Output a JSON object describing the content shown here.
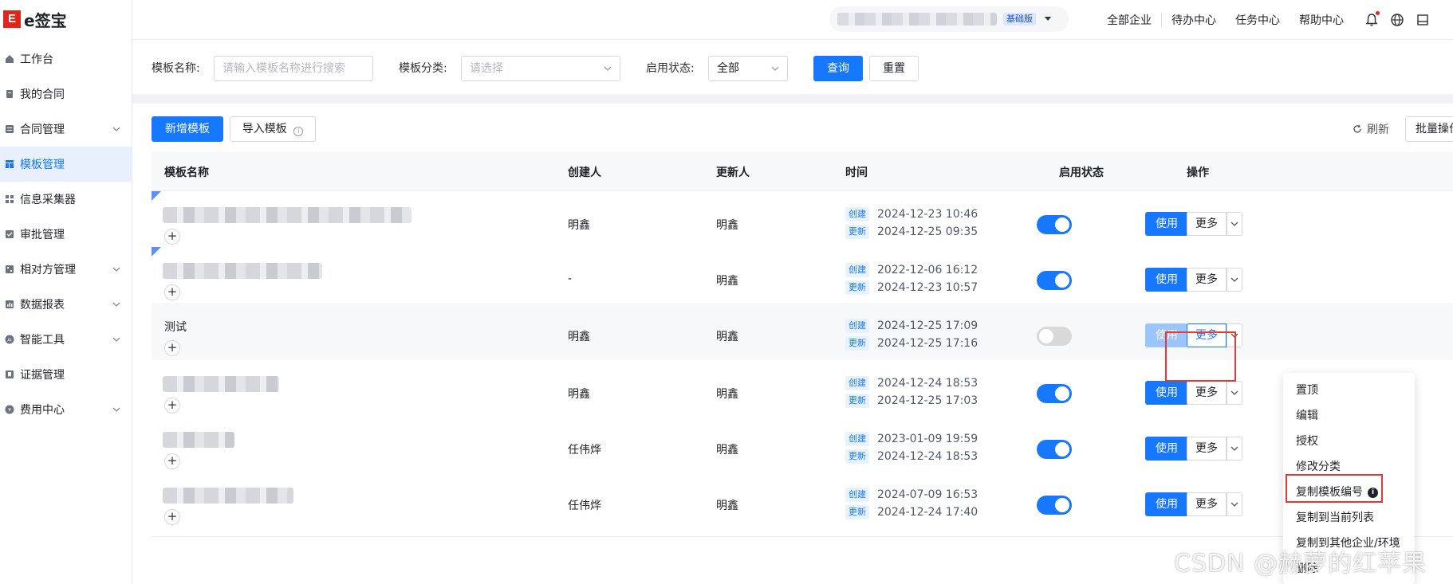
{
  "app": {
    "logo_mark": "E",
    "logo_text": "e签宝"
  },
  "sidebar": {
    "items": [
      {
        "label": "工作台",
        "icon": "home-icon",
        "expandable": false
      },
      {
        "label": "我的合同",
        "icon": "contract-icon",
        "expandable": false
      },
      {
        "label": "合同管理",
        "icon": "contract-manage-icon",
        "expandable": true
      },
      {
        "label": "模板管理",
        "icon": "template-icon",
        "expandable": false,
        "active": true
      },
      {
        "label": "信息采集器",
        "icon": "grid-icon",
        "expandable": false
      },
      {
        "label": "审批管理",
        "icon": "approve-icon",
        "expandable": false
      },
      {
        "label": "相对方管理",
        "icon": "partner-icon",
        "expandable": true
      },
      {
        "label": "数据报表",
        "icon": "chart-icon",
        "expandable": true
      },
      {
        "label": "智能工具",
        "icon": "ai-icon",
        "expandable": true
      },
      {
        "label": "证据管理",
        "icon": "evidence-icon",
        "expandable": false
      },
      {
        "label": "费用中心",
        "icon": "fee-icon",
        "expandable": true
      }
    ]
  },
  "topbar": {
    "plan_badge": "基础版",
    "links": [
      "全部企业",
      "待办中心",
      "任务中心",
      "帮助中心"
    ]
  },
  "filter": {
    "name_label": "模板名称:",
    "name_placeholder": "请输入模板名称进行搜索",
    "category_label": "模板分类:",
    "category_placeholder": "请选择",
    "status_label": "启用状态:",
    "status_value": "全部",
    "query_label": "查询",
    "reset_label": "重置"
  },
  "toolbar": {
    "add_label": "新增模板",
    "import_label": "导入模板",
    "refresh_label": "刷新",
    "batch_label": "批量操作"
  },
  "table": {
    "columns": [
      "模板名称",
      "创建人",
      "更新人",
      "时间",
      "启用状态",
      "操作"
    ],
    "created_tag": "创建",
    "updated_tag": "更新",
    "use_label": "使用",
    "more_label": "更多",
    "rows": [
      {
        "name": "",
        "creator": "明鑫",
        "updater": "明鑫",
        "created": "2024-12-23 10:46",
        "updated": "2024-12-25 09:35",
        "enabled": true
      },
      {
        "name": "",
        "creator": "-",
        "updater": "明鑫",
        "created": "2022-12-06 16:12",
        "updated": "2024-12-23 10:57",
        "enabled": true
      },
      {
        "name": "测试",
        "creator": "明鑫",
        "updater": "明鑫",
        "created": "2024-12-25 17:09",
        "updated": "2024-12-25 17:16",
        "enabled": false
      },
      {
        "name": "",
        "creator": "明鑫",
        "updater": "明鑫",
        "created": "2024-12-24 18:53",
        "updated": "2024-12-25 17:03",
        "enabled": true
      },
      {
        "name": "",
        "creator": "任伟烨",
        "updater": "明鑫",
        "created": "2023-01-09 19:59",
        "updated": "2024-12-24 18:53",
        "enabled": true
      },
      {
        "name": "",
        "creator": "任伟烨",
        "updater": "明鑫",
        "created": "2024-07-09 16:53",
        "updated": "2024-12-24 17:40",
        "enabled": true
      }
    ]
  },
  "more_menu": {
    "items": [
      "置顶",
      "编辑",
      "授权",
      "修改分类",
      "复制模板编号",
      "复制到当前列表",
      "复制到其他企业/环境",
      "删除"
    ]
  },
  "watermark": "CSDN @赫萝的红苹果",
  "colors": {
    "primary": "#1677ff",
    "highlight": "#e53935",
    "brand": "#e1251b"
  }
}
